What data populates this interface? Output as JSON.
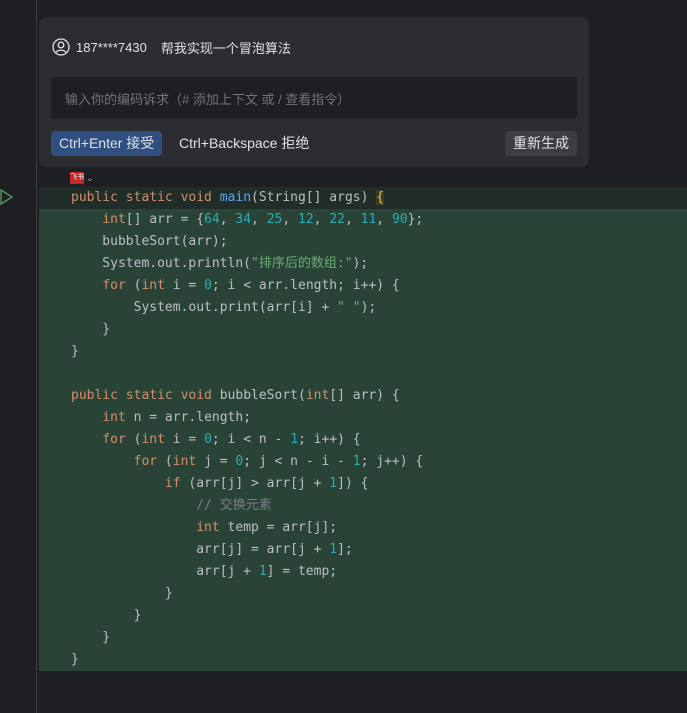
{
  "prompt": {
    "user": "187****7430",
    "message": "帮我实现一个冒泡算法",
    "input_placeholder": "输入你的编码诉求（# 添加上下文 或 / 查看指令）",
    "accept_label": "Ctrl+Enter 接受",
    "reject_label": "Ctrl+Backspace 拒绝",
    "regenerate_label": "重新生成"
  },
  "tag": {
    "label": "飞书",
    "chevron": "⌄"
  },
  "code_lines": [
    {
      "diff": false,
      "first": true,
      "tokens": [
        [
          "kw",
          "public static void "
        ],
        [
          "fn",
          "main"
        ],
        [
          "",
          "(String[] args) "
        ],
        [
          "brace-hl",
          "{"
        ]
      ]
    },
    {
      "diff": true,
      "tokens": [
        [
          "",
          "    "
        ],
        [
          "kw",
          "int"
        ],
        [
          "",
          "[] arr = {"
        ],
        [
          "num",
          "64"
        ],
        [
          "",
          ", "
        ],
        [
          "num",
          "34"
        ],
        [
          "",
          ", "
        ],
        [
          "num",
          "25"
        ],
        [
          "",
          ", "
        ],
        [
          "num",
          "12"
        ],
        [
          "",
          ", "
        ],
        [
          "num",
          "22"
        ],
        [
          "",
          ", "
        ],
        [
          "num",
          "11"
        ],
        [
          "",
          ", "
        ],
        [
          "num",
          "90"
        ],
        [
          "",
          "};"
        ]
      ]
    },
    {
      "diff": true,
      "tokens": [
        [
          "",
          "    bubbleSort(arr);"
        ]
      ]
    },
    {
      "diff": true,
      "tokens": [
        [
          "",
          "    System.out.println("
        ],
        [
          "str",
          "\"排序后的数组:\""
        ],
        [
          "",
          ");"
        ]
      ]
    },
    {
      "diff": true,
      "tokens": [
        [
          "",
          "    "
        ],
        [
          "kw",
          "for"
        ],
        [
          "",
          " ("
        ],
        [
          "kw",
          "int"
        ],
        [
          "",
          " i = "
        ],
        [
          "num",
          "0"
        ],
        [
          "",
          "; i < arr.length; i++) {"
        ]
      ]
    },
    {
      "diff": true,
      "tokens": [
        [
          "",
          "        System.out.print(arr[i] + "
        ],
        [
          "str",
          "\" \""
        ],
        [
          "",
          ");"
        ]
      ]
    },
    {
      "diff": true,
      "tokens": [
        [
          "",
          "    }"
        ]
      ]
    },
    {
      "diff": true,
      "tokens": [
        [
          "",
          "}"
        ]
      ]
    },
    {
      "diff": true,
      "tokens": [
        [
          "",
          ""
        ]
      ]
    },
    {
      "diff": true,
      "tokens": [
        [
          "kw",
          "public static void "
        ],
        [
          "",
          "bubbleSort("
        ],
        [
          "kw",
          "int"
        ],
        [
          "",
          "[] arr) {"
        ]
      ]
    },
    {
      "diff": true,
      "tokens": [
        [
          "",
          "    "
        ],
        [
          "kw",
          "int"
        ],
        [
          "",
          " n = arr.length;"
        ]
      ]
    },
    {
      "diff": true,
      "tokens": [
        [
          "",
          "    "
        ],
        [
          "kw",
          "for"
        ],
        [
          "",
          " ("
        ],
        [
          "kw",
          "int"
        ],
        [
          "",
          " i = "
        ],
        [
          "num",
          "0"
        ],
        [
          "",
          "; i < n - "
        ],
        [
          "num",
          "1"
        ],
        [
          "",
          "; i++) {"
        ]
      ]
    },
    {
      "diff": true,
      "tokens": [
        [
          "",
          "        "
        ],
        [
          "kw",
          "for"
        ],
        [
          "",
          " ("
        ],
        [
          "kw",
          "int"
        ],
        [
          "",
          " j = "
        ],
        [
          "num",
          "0"
        ],
        [
          "",
          "; j < n - i - "
        ],
        [
          "num",
          "1"
        ],
        [
          "",
          "; j++) {"
        ]
      ]
    },
    {
      "diff": true,
      "tokens": [
        [
          "",
          "            "
        ],
        [
          "kw",
          "if"
        ],
        [
          "",
          " (arr[j] > arr[j + "
        ],
        [
          "num",
          "1"
        ],
        [
          "",
          "]) {"
        ]
      ]
    },
    {
      "diff": true,
      "tokens": [
        [
          "",
          "                "
        ],
        [
          "cmt",
          "// 交换元素"
        ]
      ]
    },
    {
      "diff": true,
      "tokens": [
        [
          "",
          "                "
        ],
        [
          "kw",
          "int"
        ],
        [
          "",
          " temp = arr[j];"
        ]
      ]
    },
    {
      "diff": true,
      "tokens": [
        [
          "",
          "                arr[j] = arr[j + "
        ],
        [
          "num",
          "1"
        ],
        [
          "",
          "];"
        ]
      ]
    },
    {
      "diff": true,
      "tokens": [
        [
          "",
          "                arr[j + "
        ],
        [
          "num",
          "1"
        ],
        [
          "",
          "] = temp;"
        ]
      ]
    },
    {
      "diff": true,
      "tokens": [
        [
          "",
          "            }"
        ]
      ]
    },
    {
      "diff": true,
      "tokens": [
        [
          "",
          "        }"
        ]
      ]
    },
    {
      "diff": true,
      "tokens": [
        [
          "",
          "    }"
        ]
      ]
    },
    {
      "diff": true,
      "tokens": [
        [
          "",
          "}"
        ]
      ]
    }
  ]
}
